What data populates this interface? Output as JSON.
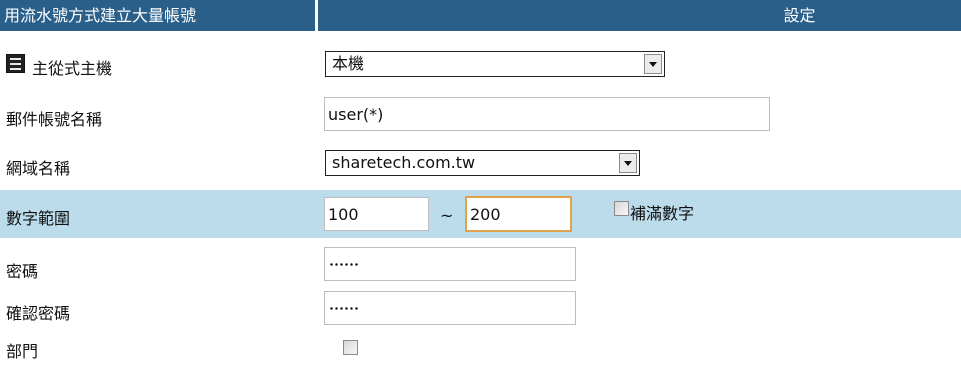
{
  "header": {
    "title": "用流水號方式建立大量帳號",
    "settings_label": "設定"
  },
  "rows": {
    "host": {
      "label": "主從式主機",
      "icon": "server-icon",
      "select_value": "本機"
    },
    "mail_account": {
      "label": "郵件帳號名稱",
      "value": "user(*)"
    },
    "domain": {
      "label": "網域名稱",
      "select_value": "sharetech.com.tw"
    },
    "number_range": {
      "label": "數字範圍",
      "from_value": "100",
      "separator": "~",
      "to_value": "200",
      "pad_checkbox_label": "補滿數字",
      "pad_checked": false
    },
    "password": {
      "label": "密碼",
      "masked_length": 6
    },
    "confirm_password": {
      "label": "確認密碼",
      "masked_length": 6
    },
    "department": {
      "label": "部門",
      "checked": false
    }
  },
  "colors": {
    "header_bg": "#2a5f8a",
    "highlight_row_bg": "#bcdcec",
    "focus_border": "#e0a24a"
  }
}
